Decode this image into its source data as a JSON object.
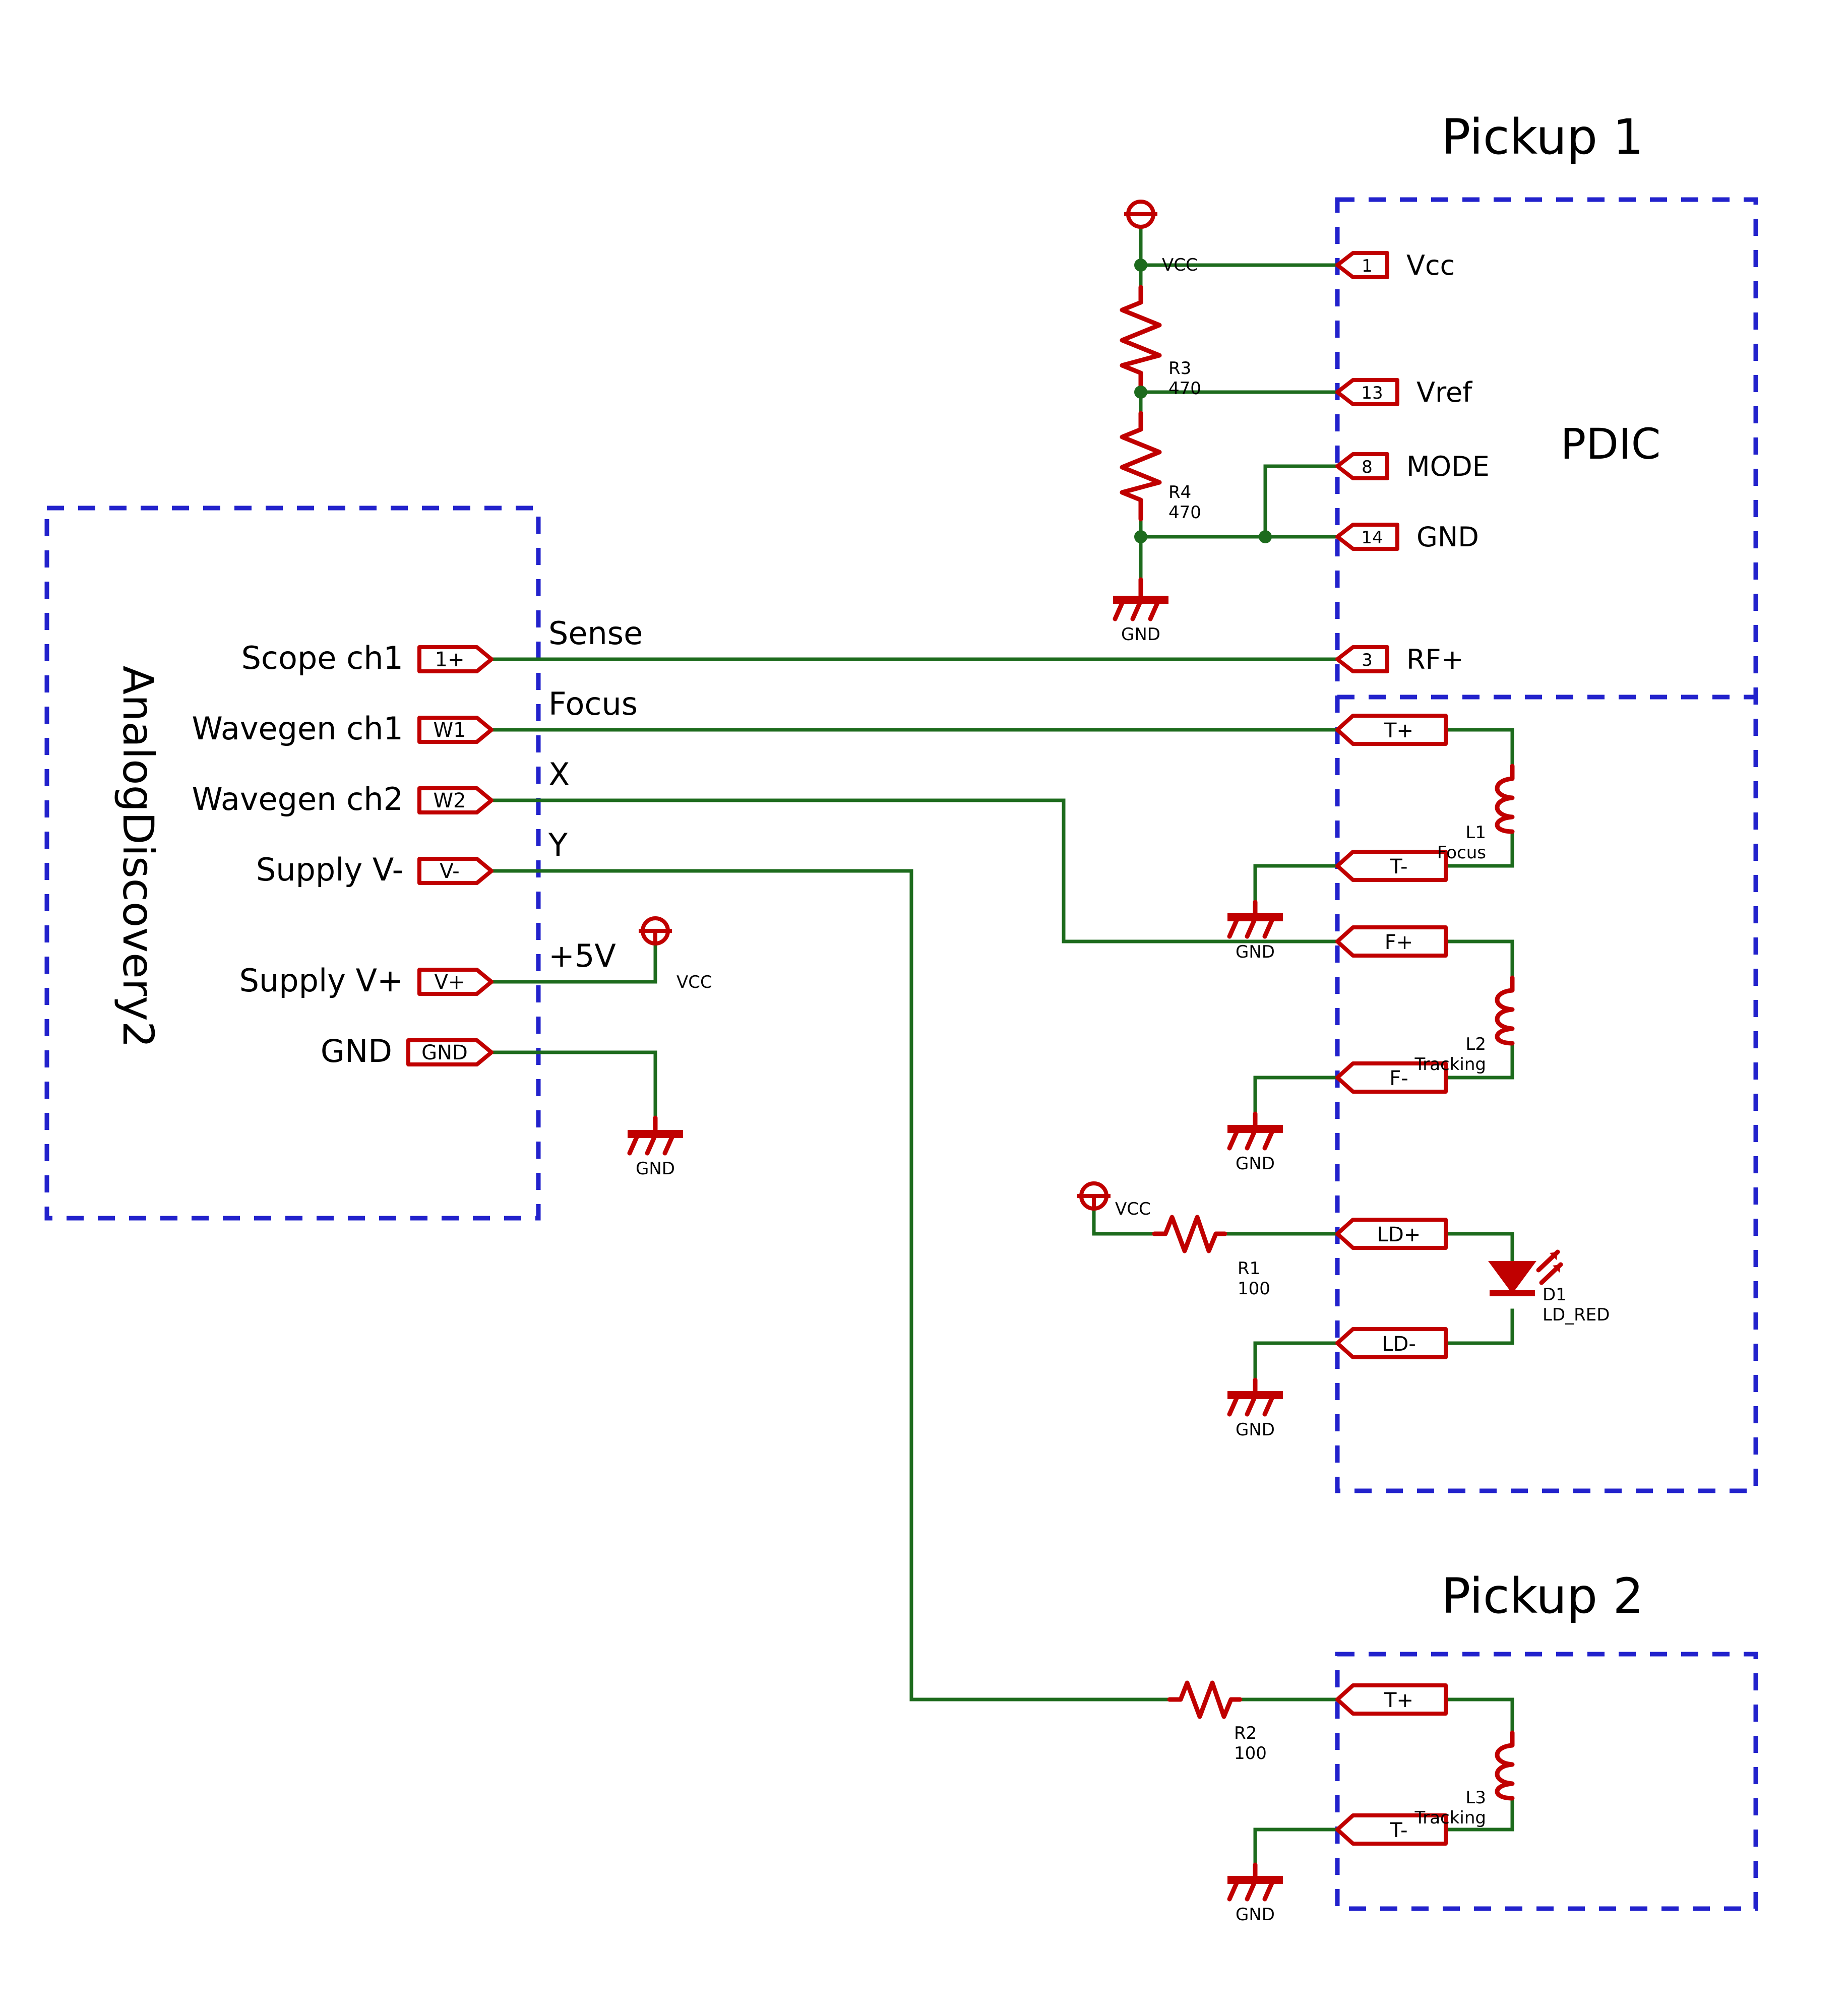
{
  "diagram": {
    "title_pickup1": "Pickup 1",
    "title_pickup2": "Pickup 2",
    "label_pdic": "PDIC",
    "label_ad2": "AnalogDiscovery2"
  },
  "ad2_ports": [
    {
      "name": "Scope ch1",
      "pin": "1+",
      "net": "Sense"
    },
    {
      "name": "Wavegen ch1",
      "pin": "W1",
      "net": "Focus"
    },
    {
      "name": "Wavegen ch2",
      "pin": "W2",
      "net": "X"
    },
    {
      "name": "Supply V-",
      "pin": "V-",
      "net": "Y"
    },
    {
      "name": "Supply V+",
      "pin": "V+",
      "net": "+5V"
    },
    {
      "name": "GND",
      "pin": "GND",
      "net": ""
    }
  ],
  "pdic_pins": [
    {
      "num": "1",
      "name": "Vcc"
    },
    {
      "num": "13",
      "name": "Vref"
    },
    {
      "num": "8",
      "name": "MODE"
    },
    {
      "num": "14",
      "name": "GND"
    },
    {
      "num": "3",
      "name": "RF+"
    }
  ],
  "pickup1_pins": [
    {
      "pin": "T+"
    },
    {
      "pin": "T-"
    },
    {
      "pin": "F+"
    },
    {
      "pin": "F-"
    },
    {
      "pin": "LD+"
    },
    {
      "pin": "LD-"
    }
  ],
  "pickup2_pins": [
    {
      "pin": "T+"
    },
    {
      "pin": "T-"
    }
  ],
  "components": [
    {
      "ref": "R3",
      "value": "470",
      "type": "resistor"
    },
    {
      "ref": "R4",
      "value": "470",
      "type": "resistor"
    },
    {
      "ref": "R1",
      "value": "100",
      "type": "resistor"
    },
    {
      "ref": "R2",
      "value": "100",
      "type": "resistor"
    },
    {
      "ref": "L1",
      "value": "Focus",
      "type": "inductor"
    },
    {
      "ref": "L2",
      "value": "Tracking",
      "type": "inductor"
    },
    {
      "ref": "L3",
      "value": "Tracking",
      "type": "inductor"
    },
    {
      "ref": "D1",
      "value": "LD_RED",
      "type": "led"
    }
  ],
  "power_symbols": [
    {
      "label": "VCC"
    },
    {
      "label": "VCC"
    },
    {
      "label": "VCC"
    }
  ],
  "gnd_symbols": [
    {
      "label": "GND"
    },
    {
      "label": "GND"
    },
    {
      "label": "GND"
    },
    {
      "label": "GND"
    },
    {
      "label": "GND"
    },
    {
      "label": "GND"
    }
  ],
  "colors": {
    "wire": "#1d6b1d",
    "component": "#c00000",
    "box": "#2222cc",
    "text": "#000000",
    "background": "#ffffff"
  }
}
